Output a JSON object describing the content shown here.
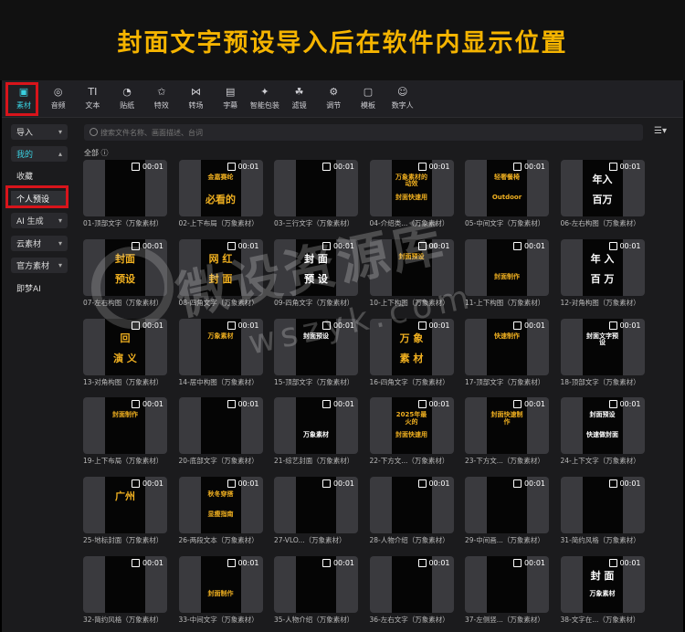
{
  "banner": {
    "title": "封面文字预设导入后在软件内显示位置"
  },
  "toolbar": {
    "items": [
      {
        "label": "素材",
        "icon": "media-icon"
      },
      {
        "label": "音频",
        "icon": "audio-icon"
      },
      {
        "label": "文本",
        "icon": "text-icon"
      },
      {
        "label": "贴纸",
        "icon": "sticker-icon"
      },
      {
        "label": "特效",
        "icon": "effects-icon"
      },
      {
        "label": "转场",
        "icon": "transition-icon"
      },
      {
        "label": "字幕",
        "icon": "subtitle-icon"
      },
      {
        "label": "智能包装",
        "icon": "smart-package-icon"
      },
      {
        "label": "滤镜",
        "icon": "filter-icon"
      },
      {
        "label": "调节",
        "icon": "adjust-icon"
      },
      {
        "label": "模板",
        "icon": "template-icon"
      },
      {
        "label": "数字人",
        "icon": "digital-human-icon"
      }
    ]
  },
  "sidebar": {
    "import": "导入",
    "mine": "我的",
    "favorites": "收藏",
    "personal_preset": "个人预设",
    "ai_generate": "AI 生成",
    "cloud": "云素材",
    "official": "官方素材",
    "jimeng": "即梦AI"
  },
  "main": {
    "search_placeholder": "搜索文件名称、画面描述、台词",
    "all_label": "全部",
    "duration": "00:01"
  },
  "cards": [
    {
      "caption": "01-顶部文字（万象素材）",
      "lines": [
        "",
        ""
      ]
    },
    {
      "caption": "02-上下布局（万象素材）",
      "lines": [
        "金嘉赛纶",
        "必看的"
      ]
    },
    {
      "caption": "03-三行文字（万象素材）",
      "lines": [
        "",
        ""
      ]
    },
    {
      "caption": "04-介绍类...（万象素材）",
      "lines": [
        "万象素材的动效",
        "封面快速用"
      ]
    },
    {
      "caption": "05-中间文字（万象素材）",
      "lines": [
        "轻奢餐椅",
        "Outdoor"
      ]
    },
    {
      "caption": "06-左右构图（万象素材）",
      "lines": [
        "年入",
        "百万"
      ]
    },
    {
      "caption": "07-左右构图（万象素材）",
      "lines": [
        "封面",
        "预设"
      ]
    },
    {
      "caption": "08-四角文字（万象素材）",
      "lines": [
        "网 红",
        "封 面"
      ]
    },
    {
      "caption": "09-四角文字（万象素材）",
      "lines": [
        "封 面",
        "预 设"
      ]
    },
    {
      "caption": "10-上下构图（万象素材）",
      "lines": [
        "封面预设",
        ""
      ]
    },
    {
      "caption": "11-上下构图（万象素材）",
      "lines": [
        "",
        "封面制作"
      ]
    },
    {
      "caption": "12-对角构图（万象素材）",
      "lines": [
        "年 入",
        "百 万"
      ]
    },
    {
      "caption": "13-对角构图（万象素材）",
      "lines": [
        "回",
        "演 义"
      ]
    },
    {
      "caption": "14-居中构图（万象素材）",
      "lines": [
        "万象素材",
        ""
      ]
    },
    {
      "caption": "15-顶部文字（万象素材）",
      "lines": [
        "封面预设",
        ""
      ]
    },
    {
      "caption": "16-四角文字（万象素材）",
      "lines": [
        "万 象",
        "素 材"
      ]
    },
    {
      "caption": "17-顶部文字（万象素材）",
      "lines": [
        "快速制作",
        ""
      ]
    },
    {
      "caption": "18-顶部文字（万象素材）",
      "lines": [
        "封面文字预设",
        ""
      ]
    },
    {
      "caption": "19-上下布局（万象素材）",
      "lines": [
        "封面制作",
        ""
      ]
    },
    {
      "caption": "20-底部文字（万象素材）",
      "lines": [
        "",
        ""
      ]
    },
    {
      "caption": "21-综艺封面（万象素材）",
      "lines": [
        "",
        "万象素材"
      ]
    },
    {
      "caption": "22-下方文...（万象素材）",
      "lines": [
        "2025年最火的",
        "封面快速用"
      ]
    },
    {
      "caption": "23-下方文...（万象素材）",
      "lines": [
        "封面快速制作",
        ""
      ]
    },
    {
      "caption": "24-上下文字（万象素材）",
      "lines": [
        "封面预设",
        "快速做封面"
      ]
    },
    {
      "caption": "25-地标封面（万象素材）",
      "lines": [
        "广州",
        ""
      ]
    },
    {
      "caption": "26-两段文本（万象素材）",
      "lines": [
        "秋冬穿搭",
        "显瘦指南"
      ]
    },
    {
      "caption": "27-VLO...（万象素材）",
      "lines": [
        "",
        ""
      ]
    },
    {
      "caption": "28-人物介绍（万象素材）",
      "lines": [
        "",
        ""
      ]
    },
    {
      "caption": "29-中间画...（万象素材）",
      "lines": [
        "",
        ""
      ]
    },
    {
      "caption": "31-简约风格（万象素材）",
      "lines": [
        "",
        ""
      ]
    },
    {
      "caption": "32-简约风格（万象素材）",
      "lines": [
        "",
        ""
      ]
    },
    {
      "caption": "33-中间文字（万象素材）",
      "lines": [
        "",
        "封面制作"
      ]
    },
    {
      "caption": "35-人物介绍（万象素材）",
      "lines": [
        "",
        ""
      ]
    },
    {
      "caption": "36-左右文字（万象素材）",
      "lines": [
        "",
        ""
      ]
    },
    {
      "caption": "37-左侧竖...（万象素材）",
      "lines": [
        "",
        ""
      ]
    },
    {
      "caption": "38-文字在...（万象素材）",
      "lines": [
        "封 面",
        "万象素材"
      ]
    }
  ],
  "watermark": {
    "main": "微设资源库",
    "sub": "wszyk.com"
  },
  "colors": {
    "accent": "#3ad0e0",
    "highlight_box": "#d8141b",
    "banner_text": "#f5b400",
    "gold_text": "#f0b020"
  }
}
